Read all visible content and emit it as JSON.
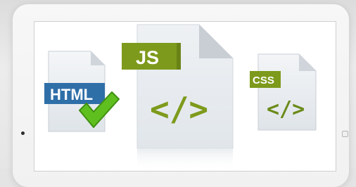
{
  "icons": {
    "html": {
      "badge": "HTML",
      "icon": "html-file-icon",
      "extra_icon": "checkmark-icon"
    },
    "js": {
      "badge": "JS",
      "symbol": "</>",
      "icon": "js-file-icon"
    },
    "css": {
      "badge": "CSS",
      "symbol": "</>",
      "icon": "css-file-icon"
    }
  },
  "colors": {
    "html_badge": "#2f6fa8",
    "check": "#5fbf1f",
    "js_badge": "#7e9a1c",
    "js_symbol": "#7e9a1c",
    "css_badge": "#7e9a1c",
    "css_symbol": "#6b8a1a",
    "page": "#e9ecef"
  }
}
